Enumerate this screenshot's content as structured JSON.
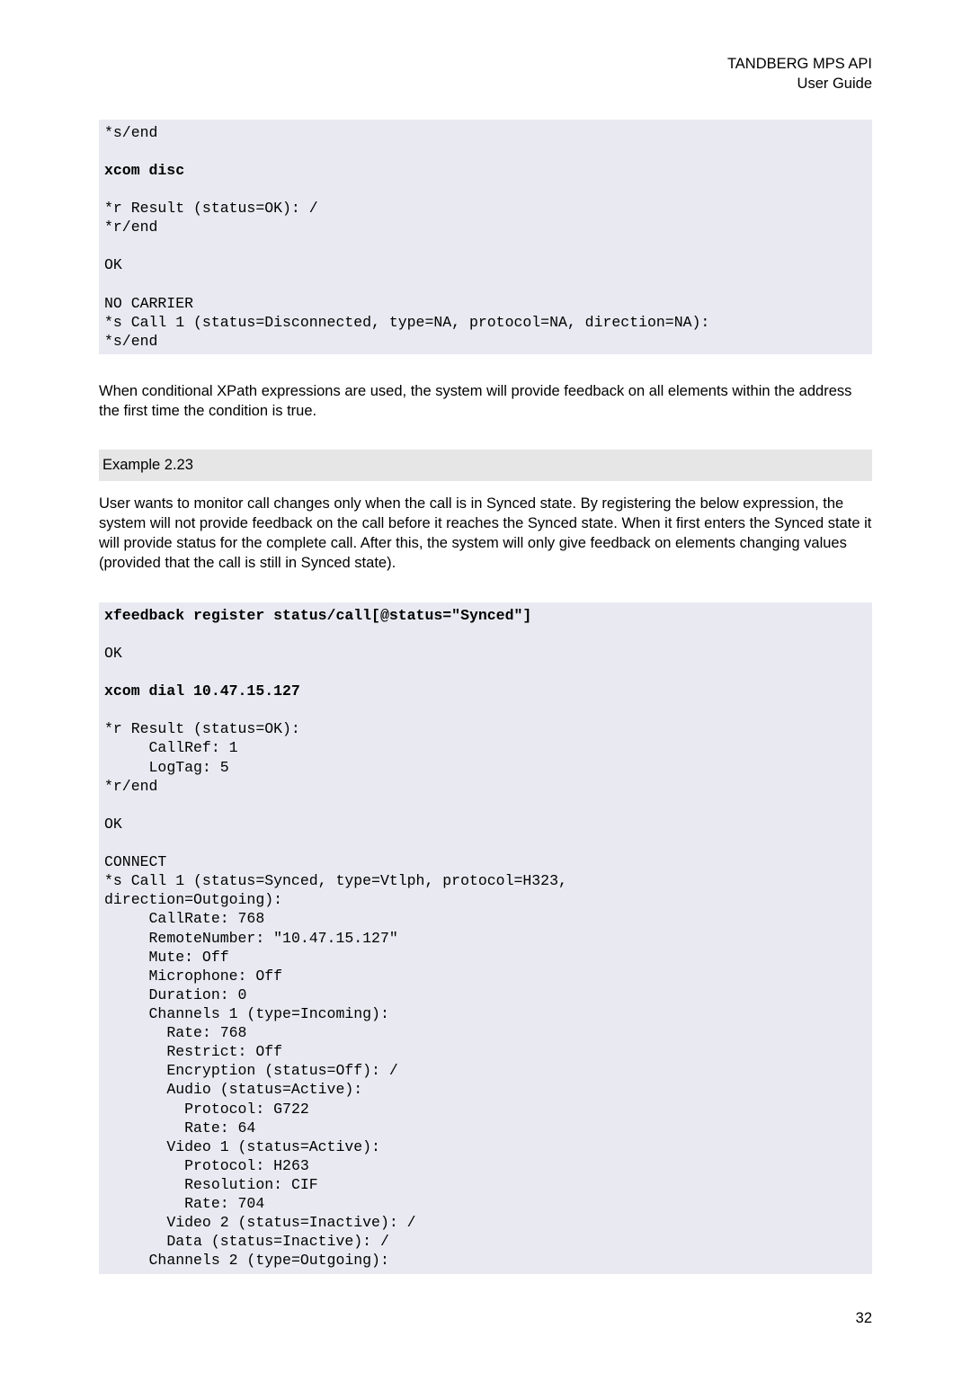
{
  "header": {
    "line1": "TANDBERG MPS API",
    "line2": "User Guide"
  },
  "code_block_1": [
    {
      "t": "*s/end",
      "b": false
    },
    {
      "t": "",
      "b": false
    },
    {
      "t": "xcom disc",
      "b": true
    },
    {
      "t": "",
      "b": false
    },
    {
      "t": "*r Result (status=OK): /",
      "b": false
    },
    {
      "t": "*r/end",
      "b": false
    },
    {
      "t": "",
      "b": false
    },
    {
      "t": "OK",
      "b": false
    },
    {
      "t": "",
      "b": false
    },
    {
      "t": "NO CARRIER",
      "b": false
    },
    {
      "t": "*s Call 1 (status=Disconnected, type=NA, protocol=NA, direction=NA):",
      "b": false
    },
    {
      "t": "*s/end ",
      "b": false
    }
  ],
  "para1": "When conditional XPath expressions are used, the system will provide feedback on all elements within the address the first time the condition is true.",
  "example_heading": "Example 2.23",
  "para2": "User wants to monitor call changes only when the call is in Synced state. By registering the below expression, the system will not provide feedback on the call before it reaches the Synced state. When it first enters the Synced state it will provide status for the complete call. After this, the system will only give feedback on elements changing values (provided that the call is still in Synced state).",
  "code_block_2": [
    {
      "t": "xfeedback register status/call[@status=\"Synced\"]",
      "b": true
    },
    {
      "t": "",
      "b": false
    },
    {
      "t": "OK",
      "b": false
    },
    {
      "t": "",
      "b": false
    },
    {
      "t": "xcom dial 10.47.15.127",
      "b": true
    },
    {
      "t": "",
      "b": false
    },
    {
      "t": "*r Result (status=OK):",
      "b": false
    },
    {
      "t": "     CallRef: 1",
      "b": false
    },
    {
      "t": "     LogTag: 5",
      "b": false
    },
    {
      "t": "*r/end",
      "b": false
    },
    {
      "t": "",
      "b": false
    },
    {
      "t": "OK",
      "b": false
    },
    {
      "t": "",
      "b": false
    },
    {
      "t": "CONNECT",
      "b": false
    },
    {
      "t": "*s Call 1 (status=Synced, type=Vtlph, protocol=H323, ",
      "b": false
    },
    {
      "t": "direction=Outgoing):",
      "b": false
    },
    {
      "t": "     CallRate: 768",
      "b": false
    },
    {
      "t": "     RemoteNumber: \"10.47.15.127\"",
      "b": false
    },
    {
      "t": "     Mute: Off",
      "b": false
    },
    {
      "t": "     Microphone: Off",
      "b": false
    },
    {
      "t": "     Duration: 0",
      "b": false
    },
    {
      "t": "     Channels 1 (type=Incoming):",
      "b": false
    },
    {
      "t": "       Rate: 768",
      "b": false
    },
    {
      "t": "       Restrict: Off",
      "b": false
    },
    {
      "t": "       Encryption (status=Off): /",
      "b": false
    },
    {
      "t": "       Audio (status=Active):",
      "b": false
    },
    {
      "t": "         Protocol: G722",
      "b": false
    },
    {
      "t": "         Rate: 64",
      "b": false
    },
    {
      "t": "       Video 1 (status=Active):",
      "b": false
    },
    {
      "t": "         Protocol: H263",
      "b": false
    },
    {
      "t": "         Resolution: CIF",
      "b": false
    },
    {
      "t": "         Rate: 704",
      "b": false
    },
    {
      "t": "       Video 2 (status=Inactive): /",
      "b": false
    },
    {
      "t": "       Data (status=Inactive): /",
      "b": false
    },
    {
      "t": "     Channels 2 (type=Outgoing):",
      "b": false
    }
  ],
  "page_number": "32"
}
